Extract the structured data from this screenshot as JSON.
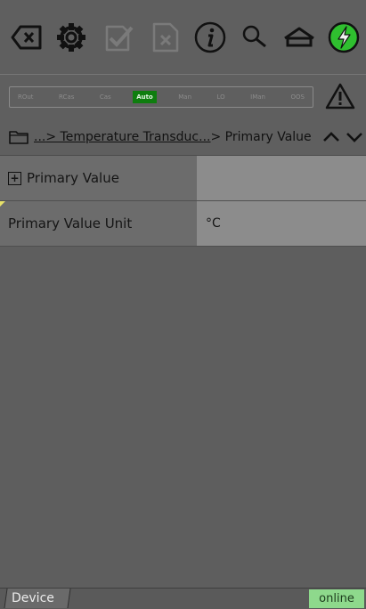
{
  "toolbar": {
    "icons": [
      "backspace-icon",
      "gear-icon",
      "checkmark-icon",
      "cancel-icon",
      "info-icon",
      "search-icon",
      "home-icon",
      "power-icon"
    ]
  },
  "modes": {
    "items": [
      "ROut",
      "RCas",
      "Cas",
      "Auto",
      "Man",
      "LO",
      "IMan",
      "OOS"
    ],
    "active": "Auto"
  },
  "breadcrumb": {
    "prefix": "...",
    "link": "> Temperature Transduc...",
    "current": "> Primary Value"
  },
  "table": {
    "rows": [
      {
        "label": "Primary Value",
        "value": ""
      },
      {
        "label": "Primary Value Unit",
        "value": "°C"
      }
    ]
  },
  "status": {
    "tab": "Device",
    "connection": "online"
  },
  "colors": {
    "active_mode": "#0e7d0e",
    "online": "#8ed98c",
    "power": "#2fbf2f"
  }
}
